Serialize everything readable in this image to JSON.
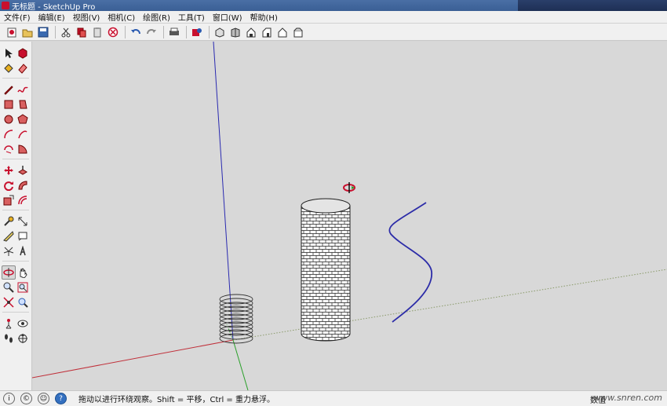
{
  "window": {
    "title": "无标题 - SketchUp Pro"
  },
  "menu": [
    "文件(F)",
    "编辑(E)",
    "视图(V)",
    "相机(C)",
    "绘图(R)",
    "工具(T)",
    "窗口(W)",
    "帮助(H)"
  ],
  "toolbar": {
    "icons": [
      "new-icon",
      "open-icon",
      "save-icon",
      "cut-icon",
      "copy-icon",
      "paste-icon",
      "erase-icon",
      "undo-icon",
      "redo-icon",
      "print-icon",
      "model-info-icon",
      "iso-view-icon",
      "top-view-icon",
      "front-view-icon",
      "right-view-icon",
      "back-view-icon",
      "left-view-icon"
    ]
  },
  "palette": {
    "active_tool": "orbit-tool"
  },
  "status": {
    "text": "拖动以进行环绕观察。Shift = 平移，Ctrl = 重力悬浮。",
    "measure_label": "数值",
    "watermark": "www.snren.com"
  },
  "colors": {
    "axis_red": "#c0303a",
    "axis_green": "#2aa02a",
    "axis_blue": "#2a2ab0",
    "curve": "#2c2ca8"
  }
}
